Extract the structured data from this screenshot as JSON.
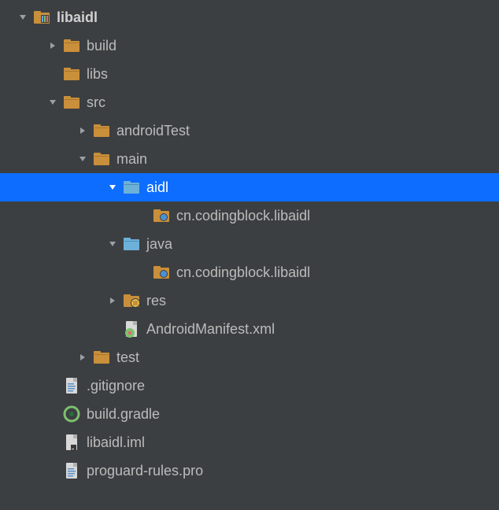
{
  "tree": [
    {
      "depth": 0,
      "arrow": "down",
      "icon": "module-folder",
      "label": "libaidl",
      "selected": false,
      "bold": true
    },
    {
      "depth": 1,
      "arrow": "right",
      "icon": "folder",
      "label": "build",
      "selected": false,
      "bold": false
    },
    {
      "depth": 1,
      "arrow": "none",
      "icon": "folder",
      "label": "libs",
      "selected": false,
      "bold": false
    },
    {
      "depth": 1,
      "arrow": "down",
      "icon": "folder",
      "label": "src",
      "selected": false,
      "bold": false
    },
    {
      "depth": 2,
      "arrow": "right",
      "icon": "folder",
      "label": "androidTest",
      "selected": false,
      "bold": false
    },
    {
      "depth": 2,
      "arrow": "down",
      "icon": "folder",
      "label": "main",
      "selected": false,
      "bold": false
    },
    {
      "depth": 3,
      "arrow": "down",
      "icon": "source-folder",
      "label": "aidl",
      "selected": true,
      "bold": false
    },
    {
      "depth": 4,
      "arrow": "none",
      "icon": "package",
      "label": "cn.codingblock.libaidl",
      "selected": false,
      "bold": false
    },
    {
      "depth": 3,
      "arrow": "down",
      "icon": "source-folder",
      "label": "java",
      "selected": false,
      "bold": false
    },
    {
      "depth": 4,
      "arrow": "none",
      "icon": "package",
      "label": "cn.codingblock.libaidl",
      "selected": false,
      "bold": false
    },
    {
      "depth": 3,
      "arrow": "right",
      "icon": "res-folder",
      "label": "res",
      "selected": false,
      "bold": false
    },
    {
      "depth": 3,
      "arrow": "none",
      "icon": "manifest-file",
      "label": "AndroidManifest.xml",
      "selected": false,
      "bold": false
    },
    {
      "depth": 2,
      "arrow": "right",
      "icon": "folder",
      "label": "test",
      "selected": false,
      "bold": false
    },
    {
      "depth": 1,
      "arrow": "none",
      "icon": "text-file",
      "label": ".gitignore",
      "selected": false,
      "bold": false
    },
    {
      "depth": 1,
      "arrow": "none",
      "icon": "gradle-file",
      "label": "build.gradle",
      "selected": false,
      "bold": false
    },
    {
      "depth": 1,
      "arrow": "none",
      "icon": "iml-file",
      "label": "libaidl.iml",
      "selected": false,
      "bold": false
    },
    {
      "depth": 1,
      "arrow": "none",
      "icon": "text-file",
      "label": "proguard-rules.pro",
      "selected": false,
      "bold": false
    }
  ],
  "layout": {
    "baseIndent": 22,
    "perLevelIndent": 38
  }
}
